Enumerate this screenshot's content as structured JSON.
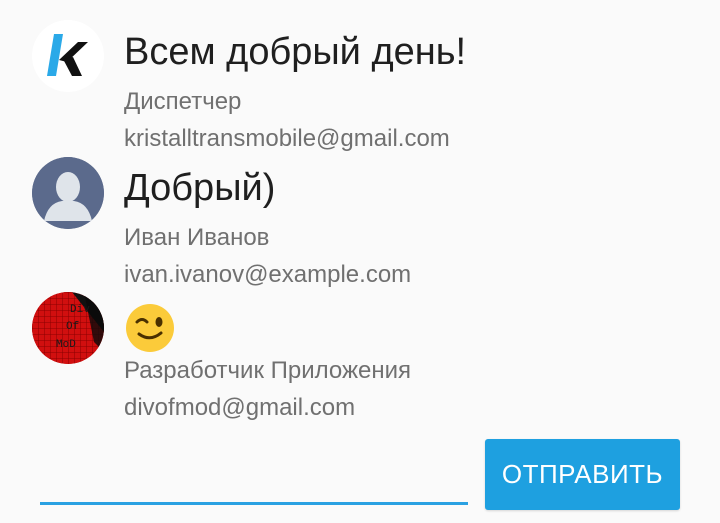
{
  "messages": [
    {
      "text": "Всем добрый день!",
      "sender": "Диспетчер",
      "email": "kristalltransmobile@gmail.com",
      "avatar_icon": "k-logo-icon"
    },
    {
      "text": "Добрый)",
      "sender": "Иван Иванов",
      "email": "ivan.ivanov@example.com",
      "avatar_icon": "default-user-icon"
    },
    {
      "text": "😉",
      "sender": "Разработчик Приложения",
      "email": "divofmod@gmail.com",
      "avatar_icon": "div-of-mod-icon",
      "avatar_text": [
        "Div",
        "Of",
        "MoD"
      ]
    }
  ],
  "composer": {
    "input_value": "",
    "send_label": "ОТПРАВИТЬ"
  },
  "colors": {
    "accent": "#1ea0e0",
    "input_underline": "#2aa1e2",
    "secondary_text": "#707070",
    "primary_text": "#1f1f1f",
    "background": "#fafafa"
  }
}
